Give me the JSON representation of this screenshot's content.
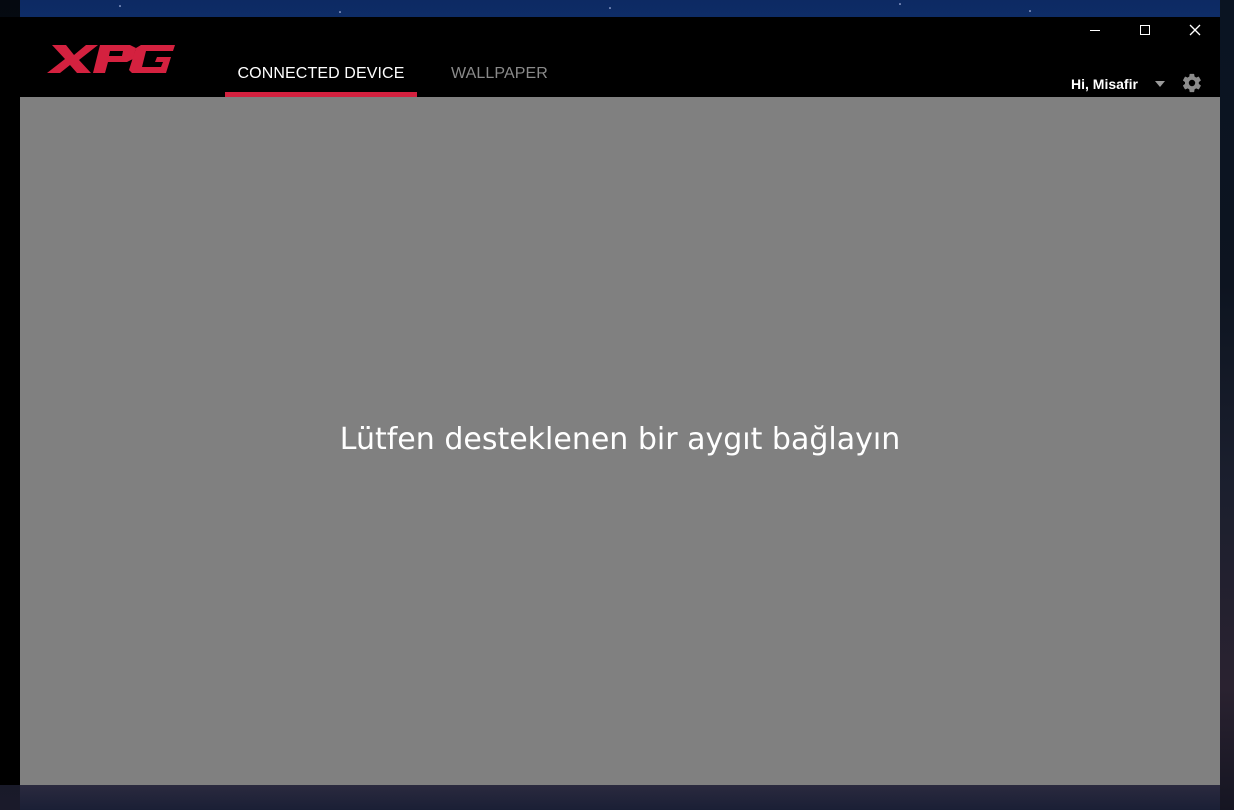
{
  "app": {
    "brand": "XPG",
    "brand_color": "#d4213f"
  },
  "tabs": [
    {
      "label": "CONNECTED DEVICE",
      "active": true
    },
    {
      "label": "WALLPAPER",
      "active": false
    }
  ],
  "user_menu": {
    "greeting": "Hi, Misafir",
    "icon": "chevron-down-icon"
  },
  "settings": {
    "icon": "gear-icon"
  },
  "window_controls": {
    "minimize_icon": "minimize-icon",
    "maximize_icon": "maximize-icon",
    "close_icon": "close-icon"
  },
  "main": {
    "message": "Lütfen desteklenen bir aygıt bağlayın",
    "background": "#808080"
  }
}
